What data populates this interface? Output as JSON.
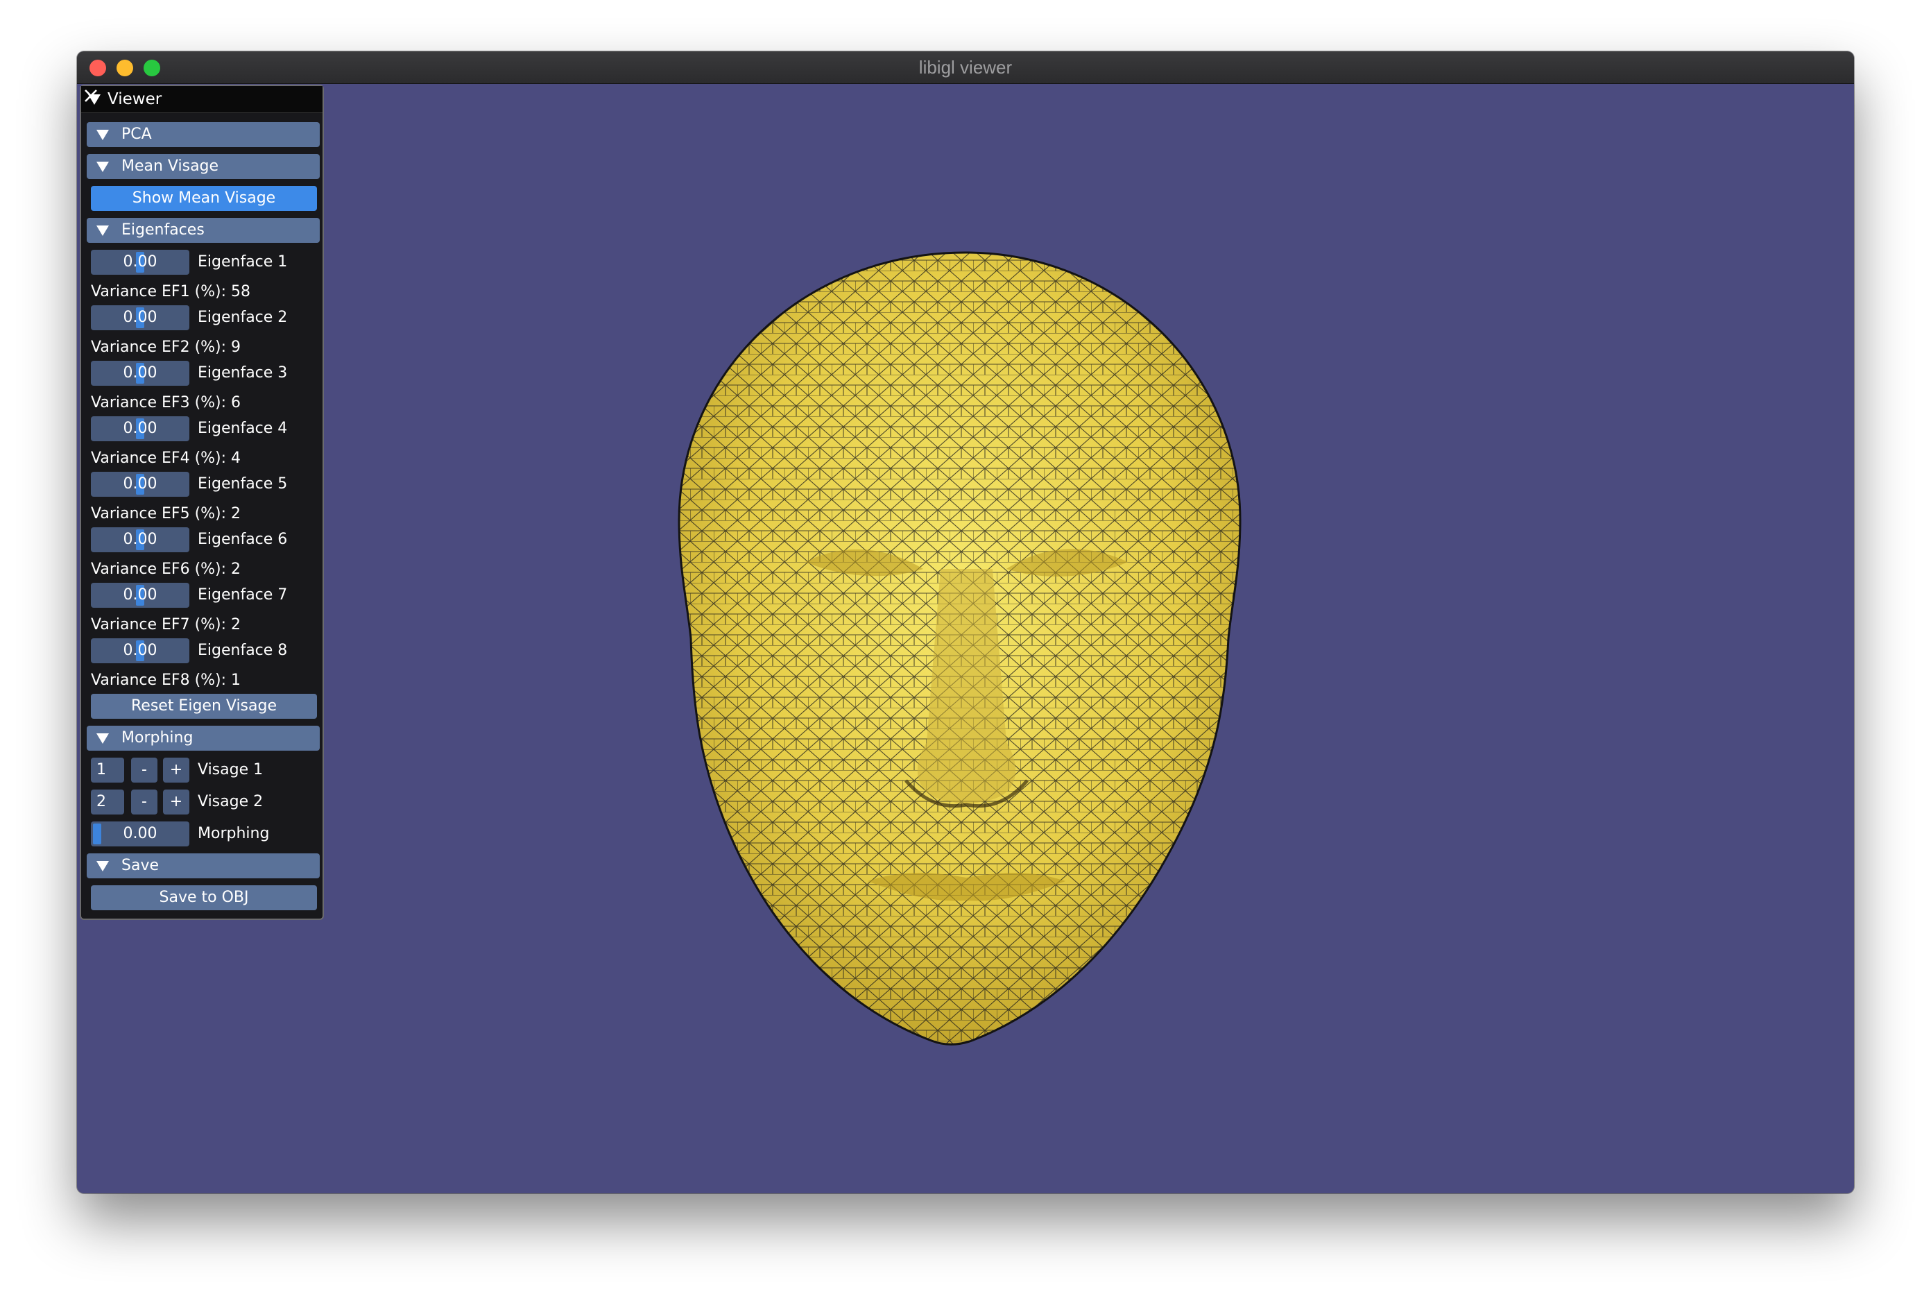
{
  "window": {
    "title": "libigl viewer",
    "viewport_background": "#4b4b7f"
  },
  "panel": {
    "title": "Viewer",
    "sections": {
      "pca": "PCA",
      "mean_visage": {
        "header": "Mean Visage",
        "button": "Show Mean Visage"
      },
      "eigenfaces": {
        "header": "Eigenfaces",
        "items": [
          {
            "value": "0.00",
            "label": "Eigenface 1",
            "variance": "Variance EF1 (%): 58"
          },
          {
            "value": "0.00",
            "label": "Eigenface 2",
            "variance": "Variance EF2 (%): 9"
          },
          {
            "value": "0.00",
            "label": "Eigenface 3",
            "variance": "Variance EF3 (%): 6"
          },
          {
            "value": "0.00",
            "label": "Eigenface 4",
            "variance": "Variance EF4 (%): 4"
          },
          {
            "value": "0.00",
            "label": "Eigenface 5",
            "variance": "Variance EF5 (%): 2"
          },
          {
            "value": "0.00",
            "label": "Eigenface 6",
            "variance": "Variance EF6 (%): 2"
          },
          {
            "value": "0.00",
            "label": "Eigenface 7",
            "variance": "Variance EF7 (%): 2"
          },
          {
            "value": "0.00",
            "label": "Eigenface 8",
            "variance": "Variance EF8 (%): 1"
          }
        ],
        "reset_button": "Reset Eigen Visage"
      },
      "morphing": {
        "header": "Morphing",
        "visage1": {
          "value": "1",
          "minus": "-",
          "plus": "+",
          "label": "Visage 1"
        },
        "visage2": {
          "value": "2",
          "minus": "-",
          "plus": "+",
          "label": "Visage 2"
        },
        "slider": {
          "value": "0.00",
          "label": "Morphing"
        }
      },
      "save": {
        "header": "Save",
        "button": "Save to OBJ"
      }
    }
  },
  "mesh": {
    "fill_color": "#e9d24f",
    "wire_color": "#141414"
  }
}
